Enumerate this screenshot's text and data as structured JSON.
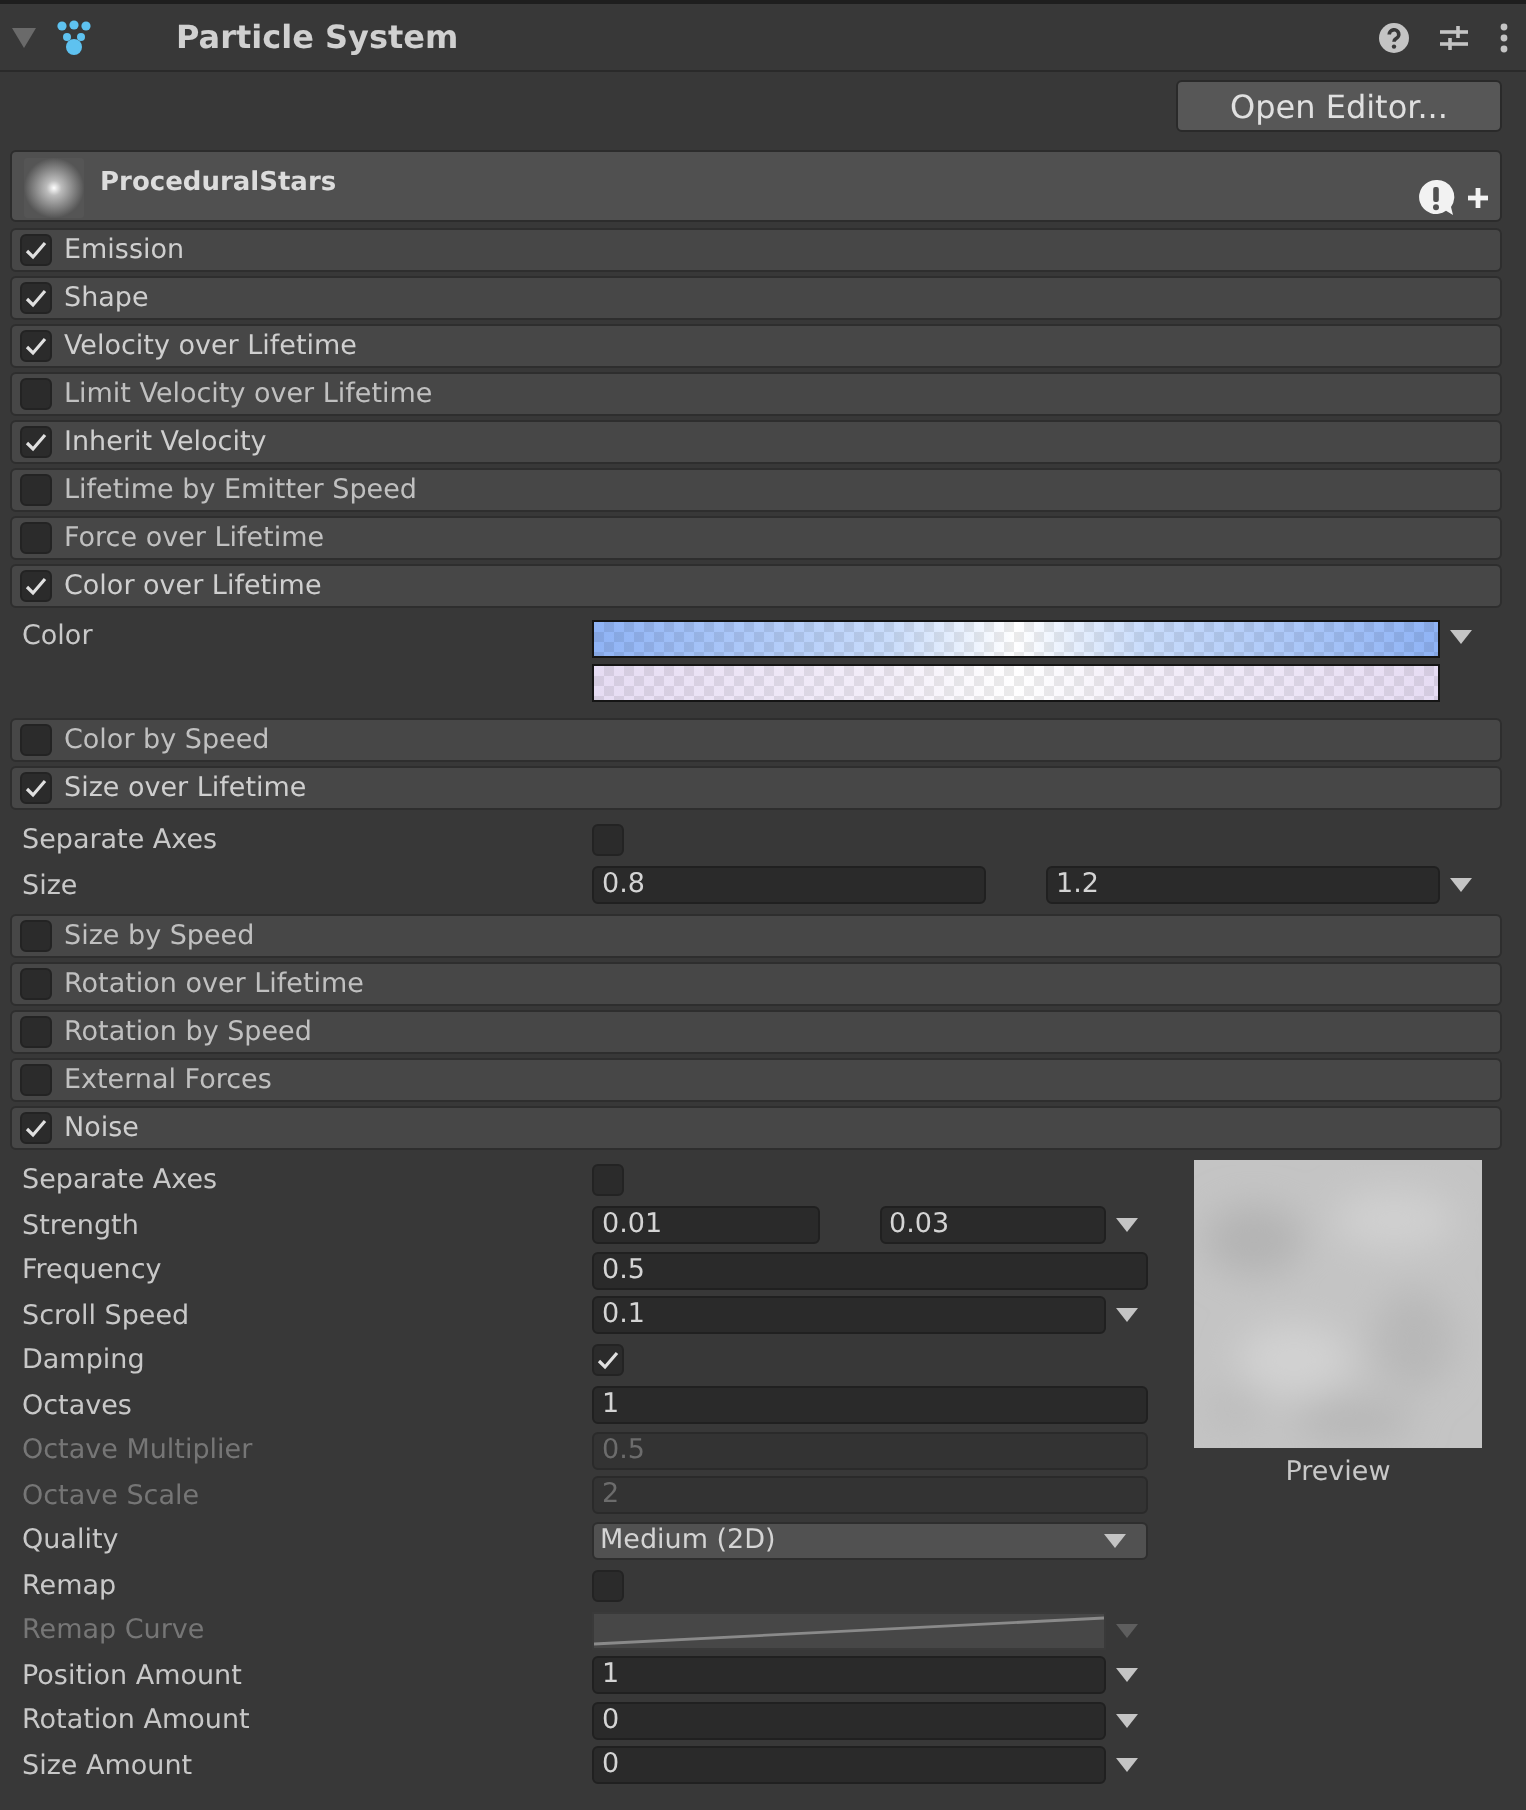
{
  "component": {
    "title": "Particle System"
  },
  "open_editor_button": "Open Editor...",
  "system": {
    "name": "ProceduralStars"
  },
  "modules": [
    {
      "name": "Emission",
      "enabled": true
    },
    {
      "name": "Shape",
      "enabled": true
    },
    {
      "name": "Velocity over Lifetime",
      "enabled": true
    },
    {
      "name": "Limit Velocity over Lifetime",
      "enabled": false
    },
    {
      "name": "Inherit Velocity",
      "enabled": true
    },
    {
      "name": "Lifetime by Emitter Speed",
      "enabled": false
    },
    {
      "name": "Force over Lifetime",
      "enabled": false
    },
    {
      "name": "Color over Lifetime",
      "enabled": true,
      "properties": [
        {
          "kind": "gradient",
          "label": "Color",
          "disabled": false,
          "dropdown": true
        }
      ]
    },
    {
      "name": "Color by Speed",
      "enabled": false
    },
    {
      "name": "Size over Lifetime",
      "enabled": true,
      "properties": [
        {
          "kind": "checkbox",
          "label": "Separate Axes",
          "disabled": false,
          "checked": false
        },
        {
          "kind": "range",
          "label": "Size",
          "disabled": false,
          "values": [
            "0.8",
            "1.2"
          ],
          "dropdown": true
        }
      ]
    },
    {
      "name": "Size by Speed",
      "enabled": false
    },
    {
      "name": "Rotation over Lifetime",
      "enabled": false
    },
    {
      "name": "Rotation by Speed",
      "enabled": false
    },
    {
      "name": "External Forces",
      "enabled": false
    },
    {
      "name": "Noise",
      "enabled": true,
      "preview": {
        "label": "Preview"
      },
      "properties": [
        {
          "kind": "checkbox",
          "label": "Separate Axes",
          "disabled": false,
          "checked": false
        },
        {
          "kind": "range",
          "label": "Strength",
          "disabled": false,
          "values": [
            "0.01",
            "0.03"
          ],
          "dropdown": true
        },
        {
          "kind": "field",
          "label": "Frequency",
          "disabled": false,
          "value": "0.5",
          "dropdown": false
        },
        {
          "kind": "field",
          "label": "Scroll Speed",
          "disabled": false,
          "value": "0.1",
          "dropdown": true
        },
        {
          "kind": "checkbox",
          "label": "Damping",
          "disabled": false,
          "checked": true
        },
        {
          "kind": "field",
          "label": "Octaves",
          "disabled": false,
          "value": "1",
          "dropdown": false
        },
        {
          "kind": "field",
          "label": "Octave Multiplier",
          "disabled": true,
          "value": "0.5",
          "dropdown": false
        },
        {
          "kind": "field",
          "label": "Octave Scale",
          "disabled": true,
          "value": "2",
          "dropdown": false
        },
        {
          "kind": "select",
          "label": "Quality",
          "disabled": false,
          "value": "Medium (2D)"
        },
        {
          "kind": "checkbox",
          "label": "Remap",
          "disabled": false,
          "checked": false
        },
        {
          "kind": "curve",
          "label": "Remap Curve",
          "disabled": true,
          "dropdown": true
        },
        {
          "kind": "field",
          "label": "Position Amount",
          "disabled": false,
          "value": "1",
          "dropdown": true
        },
        {
          "kind": "field",
          "label": "Rotation Amount",
          "disabled": false,
          "value": "0",
          "dropdown": true
        },
        {
          "kind": "field",
          "label": "Size Amount",
          "disabled": false,
          "value": "0",
          "dropdown": true
        }
      ]
    }
  ]
}
